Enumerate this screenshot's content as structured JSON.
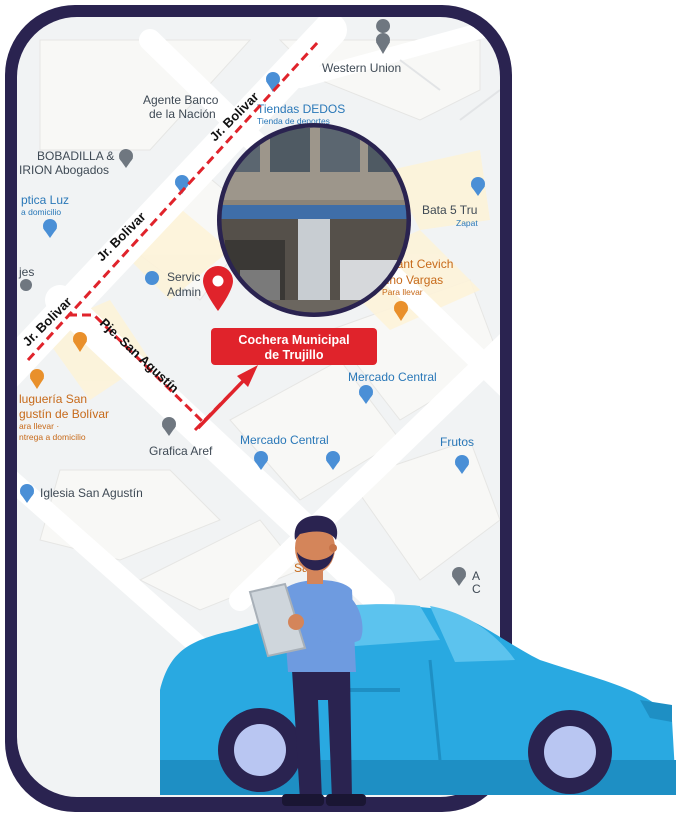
{
  "callout": {
    "line1": "Cochera Municipal",
    "line2": "de Trujillo"
  },
  "streets": {
    "bolivar_1": "Jr. Bolivar",
    "bolivar_2": "Jr. Bolivar",
    "bolivar_3": "Jr. Bolivar",
    "san_agustin": "Pje. San Agustín"
  },
  "pois": {
    "western_union": "Western Union",
    "agente_banco_1": "Agente Banco",
    "agente_banco_2": "de la Nación",
    "tiendas_dedos": "Tiendas DEDOS",
    "tiendas_dedos_sub": "Tienda de deportes",
    "bobadilla_1": "BOBADILLA &",
    "bobadilla_2": "IRION Abogados",
    "botica_1": "ptica Luz",
    "botica_2": "a domicilio",
    "bata": "Bata 5 Tru",
    "bata_sub": "Zapat",
    "servicio_1": "Servic",
    "servicio_2": "Admin",
    "ajes": "jes",
    "restaurant_1": "staurant Cevich",
    "restaurant_2": "nino Vargas",
    "restaurant_sub": "Para llevar",
    "mercado_central_1": "Mercado Central",
    "jugueria_1": "luguería San",
    "jugueria_2": "gustín de Bolívar",
    "jugueria_sub1": "ara llevar ·",
    "jugueria_sub2": "ntrega a domicilio",
    "grafica_aref": "Grafica Aref",
    "mercado_central_2": "Mercado Central",
    "frutos": "Frutos",
    "iglesia": "Iglesia San Agustín",
    "sa_partial": "Sa",
    "a_partial_1": "A",
    "a_partial_2": "C"
  },
  "colors": {
    "frame": "#2a2350",
    "route": "#e0232b",
    "callout_bg": "#e0232b",
    "car": "#29a9e1",
    "map_bg": "#f1f3f4"
  },
  "icons": {
    "pin": "map-pin-icon",
    "photo": "building-photo"
  }
}
